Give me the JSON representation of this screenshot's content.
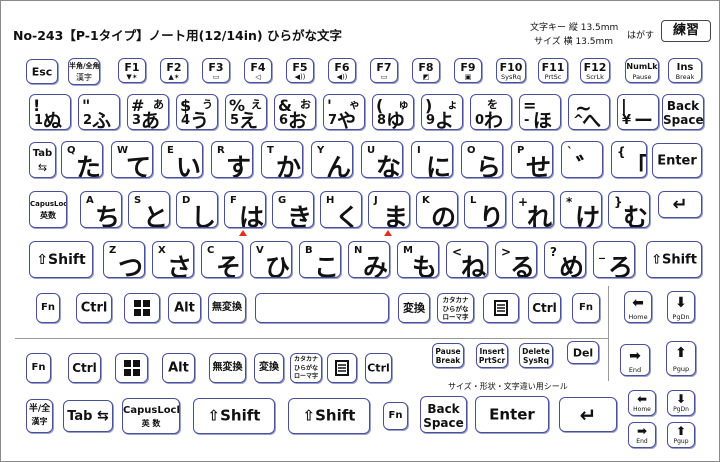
{
  "header": {
    "title": "No-243【P-1タイプ】ノート用(12/14in) ひらがな文字",
    "size_label_line1": "文字キー 縦 13.5mm",
    "size_label_line2": "サイズ 横 13.5mm",
    "font_label": "はがす",
    "brand_label": "練習"
  },
  "fn_row": [
    {
      "label": "Esc",
      "sub": ""
    },
    {
      "label": "半角/全角",
      "sub": "漢字"
    },
    {
      "label": "F1",
      "sub": "▼✶"
    },
    {
      "label": "F2",
      "sub": "▲✶"
    },
    {
      "label": "F3",
      "sub": "▭"
    },
    {
      "label": "F4",
      "sub": "◁"
    },
    {
      "label": "F5",
      "sub": "◀))"
    },
    {
      "label": "F6",
      "sub": "◀))"
    },
    {
      "label": "F7",
      "sub": "▭"
    },
    {
      "label": "F8",
      "sub": "◩"
    },
    {
      "label": "F9",
      "sub": "▣"
    },
    {
      "label": "F10",
      "sub": "SysRq"
    },
    {
      "label": "F11",
      "sub": "PrtSc"
    },
    {
      "label": "F12",
      "sub": "ScrLk"
    },
    {
      "label": "NumLk",
      "sub": "Pause"
    },
    {
      "label": "Ins",
      "sub": "Break"
    }
  ],
  "number_row": [
    {
      "top": "!",
      "main": "1",
      "kana": "ぬ",
      "sub": ""
    },
    {
      "top": "\"",
      "main": "2",
      "kana": "ふ",
      "sub": ""
    },
    {
      "top": "#",
      "main": "3",
      "kana": "あ",
      "sub": "あ"
    },
    {
      "top": "$",
      "main": "4",
      "kana": "う",
      "sub": "う"
    },
    {
      "top": "%",
      "main": "5",
      "kana": "え",
      "sub": "え"
    },
    {
      "top": "&",
      "main": "6",
      "kana": "お",
      "sub": "お"
    },
    {
      "top": "'",
      "main": "7",
      "kana": "や",
      "sub": "ゃ"
    },
    {
      "top": "(",
      "main": "8",
      "kana": "ゆ",
      "sub": "ゅ"
    },
    {
      "top": ")",
      "main": "9",
      "kana": "よ",
      "sub": "ょ"
    },
    {
      "top": "",
      "main": "0",
      "kana": "わ",
      "sub": "を"
    },
    {
      "top": "=",
      "main": "-",
      "kana": "ほ",
      "sub": ""
    },
    {
      "top": "~",
      "main": "^",
      "kana": "へ",
      "sub": ""
    },
    {
      "top": "|",
      "main": "¥",
      "kana": "ー",
      "sub": ""
    }
  ],
  "backspace_key": {
    "line1": "Back",
    "line2": "Space"
  },
  "tab_key": {
    "line1": "Tab",
    "line2": "⇆"
  },
  "qwerty_row": [
    {
      "letter": "Q",
      "kana": "た"
    },
    {
      "letter": "W",
      "kana": "て"
    },
    {
      "letter": "E",
      "kana": "い"
    },
    {
      "letter": "R",
      "kana": "す"
    },
    {
      "letter": "T",
      "kana": "か"
    },
    {
      "letter": "Y",
      "kana": "ん"
    },
    {
      "letter": "U",
      "kana": "な"
    },
    {
      "letter": "I",
      "kana": "に"
    },
    {
      "letter": "O",
      "kana": "ら"
    },
    {
      "letter": "P",
      "kana": "せ"
    },
    {
      "letter": "`",
      "kana": "゛"
    },
    {
      "letter": "{",
      "kana": "「"
    }
  ],
  "enter_key": {
    "label": "Enter"
  },
  "capslock_key": {
    "line1": "CapusLock",
    "line2": "英数"
  },
  "asdf_row": [
    {
      "letter": "A",
      "kana": "ち"
    },
    {
      "letter": "S",
      "kana": "と"
    },
    {
      "letter": "D",
      "kana": "し"
    },
    {
      "letter": "F",
      "kana": "は"
    },
    {
      "letter": "G",
      "kana": "き"
    },
    {
      "letter": "H",
      "kana": "く"
    },
    {
      "letter": "J",
      "kana": "ま"
    },
    {
      "letter": "K",
      "kana": "の"
    },
    {
      "letter": "L",
      "kana": "り"
    },
    {
      "letter": "+",
      "kana": "れ"
    },
    {
      "letter": "*",
      "kana": "け"
    },
    {
      "letter": "}",
      "kana": "む"
    }
  ],
  "enter_arrow": "↵",
  "shift_key": {
    "label": "⇧Shift"
  },
  "zxcv_row": [
    {
      "letter": "Z",
      "kana": "つ"
    },
    {
      "letter": "X",
      "kana": "さ"
    },
    {
      "letter": "C",
      "kana": "そ"
    },
    {
      "letter": "V",
      "kana": "ひ"
    },
    {
      "letter": "B",
      "kana": "こ"
    },
    {
      "letter": "N",
      "kana": "み"
    },
    {
      "letter": "M",
      "kana": "も"
    },
    {
      "letter": "<",
      "kana": "ね"
    },
    {
      "letter": ">",
      "kana": "る"
    },
    {
      "letter": "?",
      "kana": "め"
    },
    {
      "letter": "_",
      "kana": "ろ"
    }
  ],
  "bottom_row": {
    "fn": "Fn",
    "ctrl": "Ctrl",
    "alt": "Alt",
    "muhenkan": "無変換",
    "henkan": "変換",
    "kana_l1": "カタカナ",
    "kana_l2": "ひらがな",
    "kana_l3": "ローマ字",
    "ctrl_r": "Ctrl",
    "fn_r": "Fn",
    "home": "Home",
    "pgdn": "PgDn"
  },
  "spare_row": {
    "fn": "Fn",
    "ctrl": "Ctrl",
    "alt": "Alt",
    "muhenkan": "無変換",
    "henkan": "変換",
    "kana_l1": "カタカナ",
    "kana_l2": "ひらがな",
    "kana_l3": "ローマ字",
    "ctrl_r": "Ctrl",
    "pause_l1": "Pause",
    "pause_l2": "Break",
    "insert_l1": "Insert",
    "insert_l2": "PrtScr",
    "delete_l1": "Delete",
    "delete_l2": "SysRq",
    "del": "Del",
    "end": "End",
    "pgup": "Pgup"
  },
  "seal_caption": "サイズ・形状・文字違い用シール",
  "last_row": {
    "hankaku_l1": "半/全",
    "hankaku_l2": "漢字",
    "tab": "Tab",
    "tab_arrow": "⇆",
    "caps_l1": "CapusLock",
    "caps_l2": "英 数",
    "shift1": "⇧Shift",
    "shift2": "⇧Shift",
    "fn": "Fn",
    "back_l1": "Back",
    "back_l2": "Space",
    "enter": "Enter",
    "enter_arrow": "↵",
    "home": "Home",
    "pgdn": "PgDn",
    "end": "End",
    "pgup": "Pgup"
  }
}
